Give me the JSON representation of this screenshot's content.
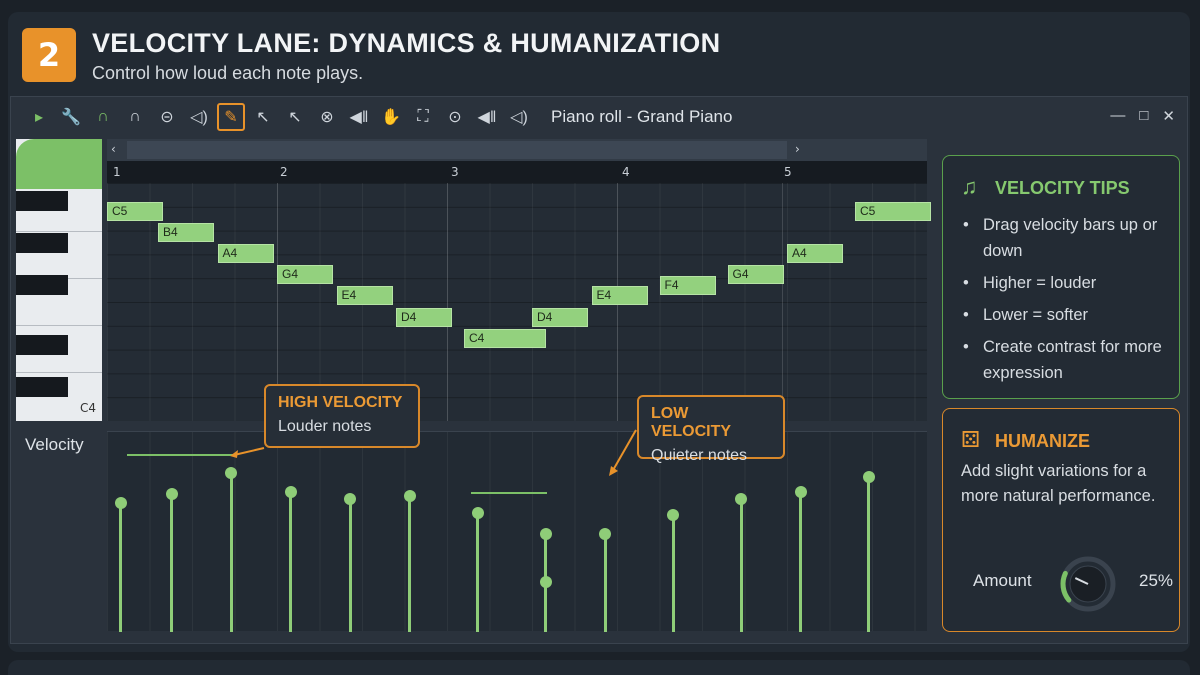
{
  "header": {
    "step": "2",
    "title": "VELOCITY LANE: DYNAMICS & HUMANIZATION",
    "subtitle": "Control how loud each note plays."
  },
  "window": {
    "title": "Piano roll - Grand Piano",
    "controls": [
      "—",
      "□",
      "✕"
    ]
  },
  "toolbar": {
    "tools": [
      {
        "icon": "play-icon",
        "glyph": "▸",
        "color": "green"
      },
      {
        "icon": "wrench-icon",
        "glyph": "🔧",
        "color": "green"
      },
      {
        "icon": "magnet-icon",
        "glyph": "∩",
        "color": "green"
      },
      {
        "icon": "loop-icon",
        "glyph": "∩",
        "color": "default"
      },
      {
        "icon": "pencil-circle-icon",
        "glyph": "⊝",
        "color": "default"
      },
      {
        "icon": "speaker-icon",
        "glyph": "◁)",
        "color": "default"
      },
      {
        "icon": "paintbrush-icon",
        "glyph": "✎",
        "color": "active"
      },
      {
        "icon": "select-icon",
        "glyph": "↖",
        "color": "default"
      },
      {
        "icon": "pencil-cursor-icon",
        "glyph": "↖",
        "color": "default"
      },
      {
        "icon": "delete-icon",
        "glyph": "⊗",
        "color": "default"
      },
      {
        "icon": "mute-icon",
        "glyph": "◀‖",
        "color": "default"
      },
      {
        "icon": "hand-icon",
        "glyph": "✋",
        "color": "default"
      },
      {
        "icon": "zoom-frame-icon",
        "glyph": "⛶",
        "color": "default"
      },
      {
        "icon": "zoom-icon",
        "glyph": "⊙",
        "color": "default"
      },
      {
        "icon": "playback-icon",
        "glyph": "◀‖",
        "color": "default"
      },
      {
        "icon": "volume-icon",
        "glyph": "◁)",
        "color": "default"
      }
    ]
  },
  "keyboard": {
    "bottom_label": "C4"
  },
  "ruler": {
    "bars": [
      "1",
      "2",
      "3",
      "4",
      "5"
    ]
  },
  "notes": [
    {
      "pitch": "C5",
      "bar": 1.0
    },
    {
      "pitch": "B4",
      "bar": 1.3
    },
    {
      "pitch": "A4",
      "bar": 1.65
    },
    {
      "pitch": "G4",
      "bar": 2.0
    },
    {
      "pitch": "E4",
      "bar": 2.35
    },
    {
      "pitch": "D4",
      "bar": 2.7
    },
    {
      "pitch": "C4",
      "bar": 3.1
    },
    {
      "pitch": "D4",
      "bar": 3.5
    },
    {
      "pitch": "E4",
      "bar": 3.85
    },
    {
      "pitch": "F4",
      "bar": 4.25
    },
    {
      "pitch": "G4",
      "bar": 4.65
    },
    {
      "pitch": "A4",
      "bar": 5.0
    },
    {
      "pitch": "C5",
      "bar": 5.4
    }
  ],
  "velocity": {
    "label": "Velocity",
    "values": [
      0.71,
      0.76,
      0.87,
      0.77,
      0.73,
      0.75,
      0.66,
      0.55,
      0.55,
      0.65,
      0.73,
      0.77,
      0.85
    ],
    "callout_high": {
      "heading": "HIGH VELOCITY",
      "text": "Louder notes"
    },
    "callout_low": {
      "heading": "LOW VELOCITY",
      "text": "Quieter notes"
    }
  },
  "tips": {
    "title": "VELOCITY TIPS",
    "icon": "music-note-icon",
    "items": [
      "Drag velocity bars up or down",
      "Higher = louder",
      "Lower = softer",
      "Create contrast for more expression"
    ]
  },
  "humanize": {
    "title": "HUMANIZE",
    "icon": "dice-icon",
    "description": "Add slight variations for a more natural performance.",
    "amount_label": "Amount",
    "amount_value": "25%",
    "amount": 0.25
  },
  "colors": {
    "accent_orange": "#e8922a",
    "note_green": "#93d17e",
    "tips_green": "#86c96f"
  }
}
